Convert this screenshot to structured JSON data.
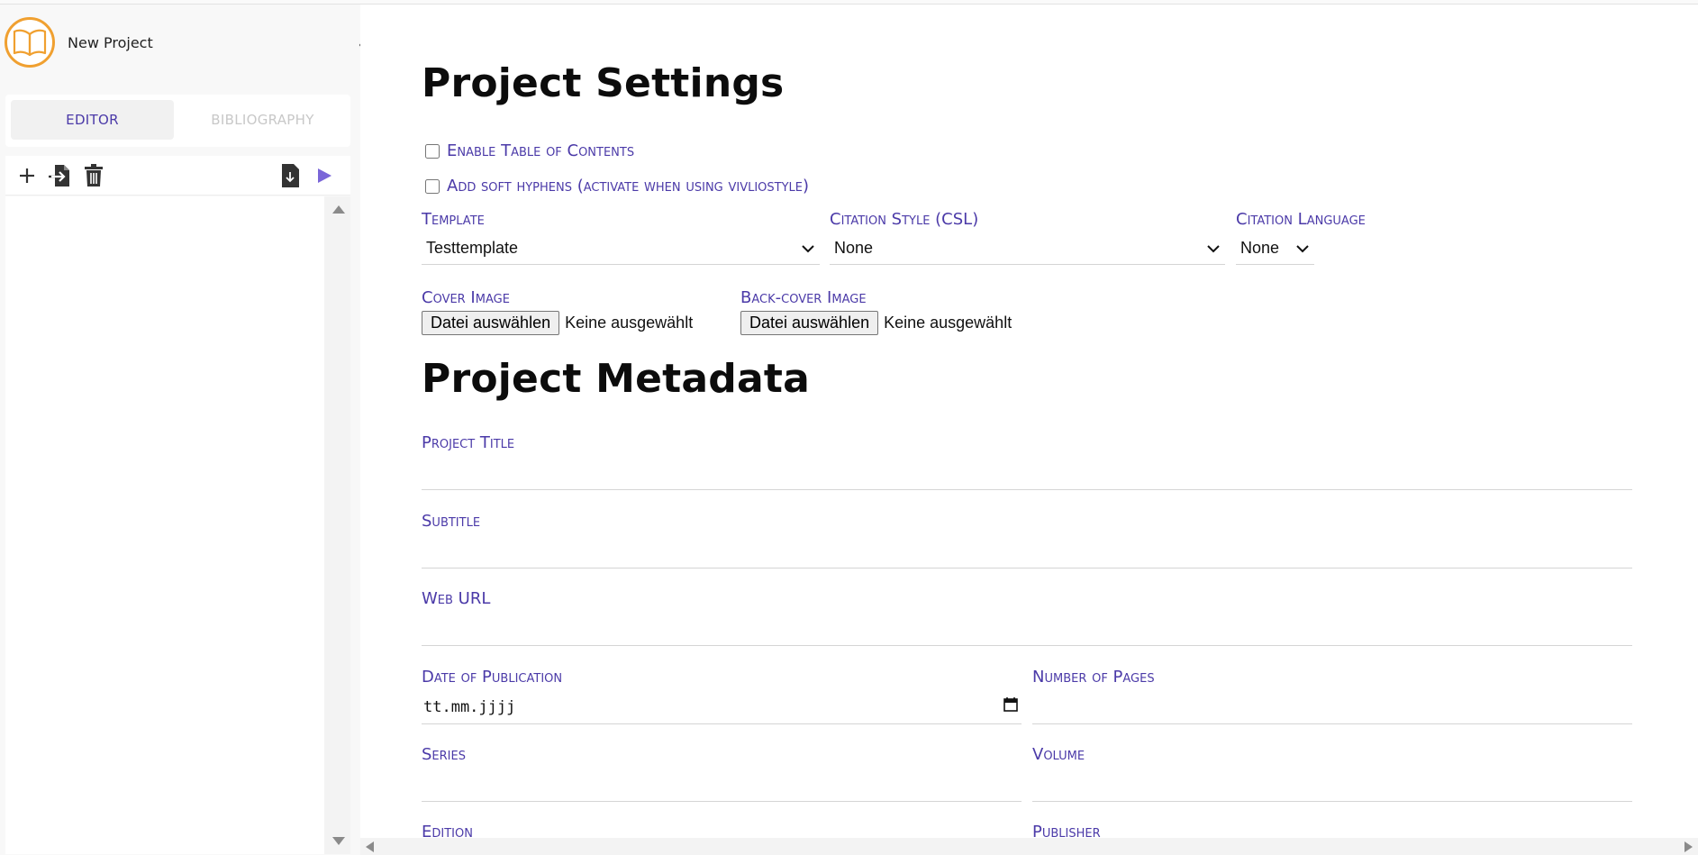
{
  "app": {
    "project_name": "New Project",
    "logo_icon": "open-book-icon",
    "accent_color": "#4b3aa8",
    "logo_color": "#f0a030"
  },
  "sidebar": {
    "tabs": [
      {
        "label": "EDITOR",
        "active": true
      },
      {
        "label": "BIBLIOGRAPHY",
        "active": false
      }
    ],
    "toolbar": {
      "left_icons": [
        "plus-icon",
        "import-file-icon",
        "trash-icon"
      ],
      "right_icons": [
        "download-file-icon",
        "play-icon"
      ]
    }
  },
  "settings": {
    "title": "Project Settings",
    "checkbox_toc": "Enable Table of Contents",
    "checkbox_hyphens": "Add soft hyphens (activate when using vivliostyle)",
    "template_label": "Template",
    "template_value": "Testtemplate",
    "csl_label": "Citation Style (CSL)",
    "csl_value": "None",
    "citation_lang_label": "Citation Language",
    "citation_lang_value": "None",
    "cover_label": "Cover Image",
    "back_cover_label": "Back-cover Image",
    "file_button": "Datei auswählen",
    "file_none": "Keine ausgewählt"
  },
  "metadata": {
    "title": "Project Metadata",
    "project_title_label": "Project Title",
    "subtitle_label": "Subtitle",
    "web_url_label": "Web URL",
    "date_label": "Date of Publication",
    "date_placeholder": "tt.mm.jjjj",
    "pages_label": "Number of Pages",
    "series_label": "Series",
    "volume_label": "Volume",
    "edition_label": "Edition",
    "publisher_label": "Publisher"
  }
}
